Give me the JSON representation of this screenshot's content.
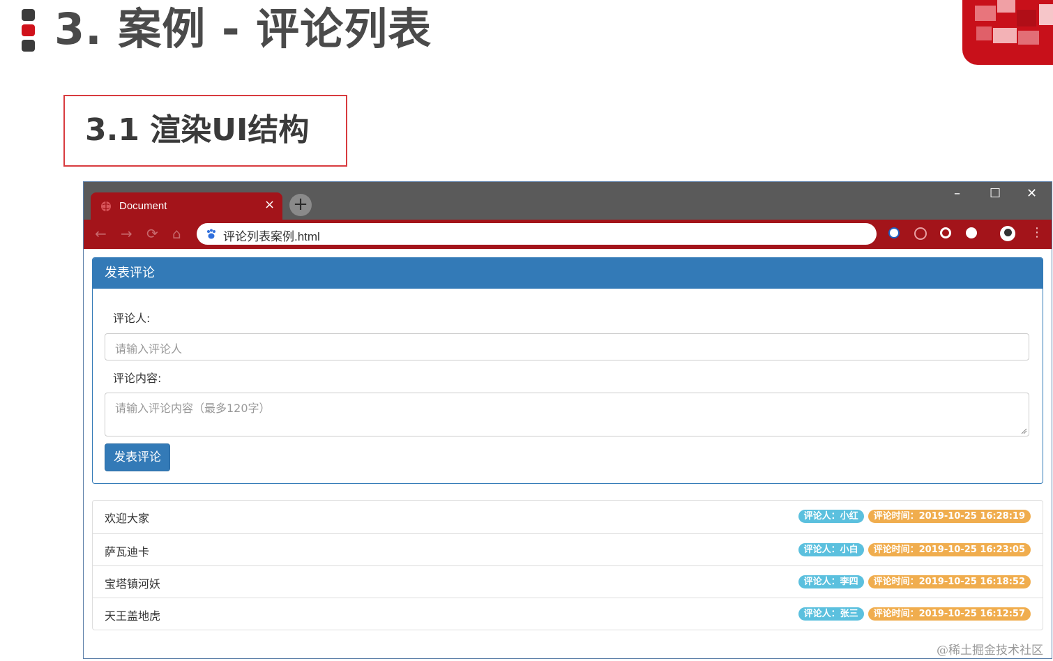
{
  "slide": {
    "title": "3. 案例 - 评论列表",
    "subsection": "3.1 渲染UI结构",
    "watermark": "@稀土掘金技术社区"
  },
  "browser": {
    "tab_title": "Document",
    "tab_close": "×",
    "new_tab": "+",
    "url": "评论列表案例.html",
    "window_controls": [
      "–",
      "☐",
      "✕"
    ],
    "nav": {
      "back": "←",
      "forward": "→",
      "reload": "⟳",
      "home": "⌂"
    },
    "icons": [
      "globe-icon",
      "paw-icon",
      "extension-icon",
      "profile-icon",
      "kebab-menu-icon"
    ]
  },
  "form": {
    "heading": "发表评论",
    "commenter_label": "评论人:",
    "commenter_placeholder": "请输入评论人",
    "content_label": "评论内容:",
    "content_placeholder": "请输入评论内容（最多120字）",
    "submit_label": "发表评论"
  },
  "comments": [
    {
      "content": "欢迎大家",
      "user": "评论人：小红",
      "time": "评论时间：2019-10-25 16:28:19"
    },
    {
      "content": "萨瓦迪卡",
      "user": "评论人：小白",
      "time": "评论时间：2019-10-25 16:23:05"
    },
    {
      "content": "宝塔镇河妖",
      "user": "评论人：李四",
      "time": "评论时间：2019-10-25 16:18:52"
    },
    {
      "content": "天王盖地虎",
      "user": "评论人：张三",
      "time": "评论时间：2019-10-25 16:12:57"
    }
  ],
  "colors": {
    "primary": "#337ab7",
    "badge_info": "#5bc0de",
    "badge_warning": "#f0ad4e",
    "browser_chrome": "#a3141a",
    "accent_red": "#d0121b"
  }
}
